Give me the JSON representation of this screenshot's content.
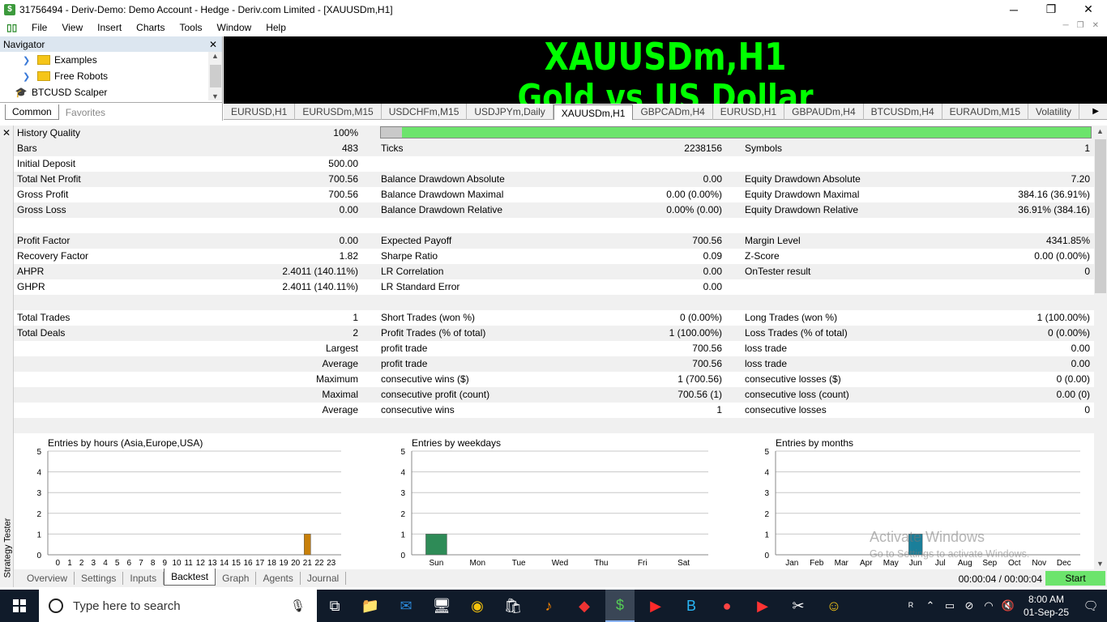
{
  "window": {
    "title": "31756494 - Deriv-Demo: Demo Account - Hedge - Deriv.com Limited - [XAUUSDm,H1]"
  },
  "menu": [
    "File",
    "View",
    "Insert",
    "Charts",
    "Tools",
    "Window",
    "Help"
  ],
  "navigator": {
    "title": "Navigator",
    "items": [
      {
        "label": "Examples",
        "icon": "folder-icon"
      },
      {
        "label": "Free Robots",
        "icon": "folder-icon"
      },
      {
        "label": "BTCUSD Scalper",
        "icon": "graduation-cap-icon"
      }
    ],
    "tabs": [
      "Common",
      "Favorites"
    ]
  },
  "chart": {
    "symbol_title": "XAUUSDm,H1",
    "description": "Gold vs US Dollar",
    "text_color": "#00ff00",
    "tabs": [
      "EURUSD,H1",
      "EURUSDm,M15",
      "USDCHFm,M15",
      "USDJPYm,Daily",
      "XAUUSDm,H1",
      "GBPCADm,H4",
      "EURUSD,H1",
      "GBPAUDm,H4",
      "BTCUSDm,H4",
      "EURAUDm,M15",
      "Volatility"
    ],
    "active_tab": 4
  },
  "report": {
    "history_quality": {
      "label": "History Quality",
      "value": "100%",
      "fraction": 1.0
    },
    "rows": [
      {
        "c": [
          "Bars",
          "483",
          "Ticks",
          "2238156",
          "Symbols",
          "1"
        ],
        "shade": true
      },
      {
        "c": [
          "Initial Deposit",
          "500.00",
          "",
          "",
          "",
          ""
        ],
        "shade": false
      },
      {
        "c": [
          "Total Net Profit",
          "700.56",
          "Balance Drawdown Absolute",
          "0.00",
          "Equity Drawdown Absolute",
          "7.20"
        ],
        "shade": true
      },
      {
        "c": [
          "Gross Profit",
          "700.56",
          "Balance Drawdown Maximal",
          "0.00 (0.00%)",
          "Equity Drawdown Maximal",
          "384.16 (36.91%)"
        ],
        "shade": false
      },
      {
        "c": [
          "Gross Loss",
          "0.00",
          "Balance Drawdown Relative",
          "0.00% (0.00)",
          "Equity Drawdown Relative",
          "36.91% (384.16)"
        ],
        "shade": true
      },
      {
        "c": [
          "",
          "",
          "",
          "",
          "",
          ""
        ],
        "shade": false
      },
      {
        "c": [
          "Profit Factor",
          "0.00",
          "Expected Payoff",
          "700.56",
          "Margin Level",
          "4341.85%"
        ],
        "shade": true
      },
      {
        "c": [
          "Recovery Factor",
          "1.82",
          "Sharpe Ratio",
          "0.09",
          "Z-Score",
          "0.00 (0.00%)"
        ],
        "shade": false
      },
      {
        "c": [
          "AHPR",
          "2.4011 (140.11%)",
          "LR Correlation",
          "0.00",
          "OnTester result",
          "0"
        ],
        "shade": true
      },
      {
        "c": [
          "GHPR",
          "2.4011 (140.11%)",
          "LR Standard Error",
          "0.00",
          "",
          ""
        ],
        "shade": false
      },
      {
        "c": [
          "",
          "",
          "",
          "",
          "",
          ""
        ],
        "shade": true
      },
      {
        "c": [
          "Total Trades",
          "1",
          "Short Trades (won %)",
          "0 (0.00%)",
          "Long Trades (won %)",
          "1 (100.00%)"
        ],
        "shade": false
      },
      {
        "c": [
          "Total Deals",
          "2",
          "Profit Trades (% of total)",
          "1 (100.00%)",
          "Loss Trades (% of total)",
          "0 (0.00%)"
        ],
        "shade": true
      },
      {
        "c": [
          "",
          "Largest",
          "profit trade",
          "700.56",
          "loss trade",
          "0.00"
        ],
        "shade": false
      },
      {
        "c": [
          "",
          "Average",
          "profit trade",
          "700.56",
          "loss trade",
          "0.00"
        ],
        "shade": true
      },
      {
        "c": [
          "",
          "Maximum",
          "consecutive wins ($)",
          "1 (700.56)",
          "consecutive losses ($)",
          "0 (0.00)"
        ],
        "shade": false
      },
      {
        "c": [
          "",
          "Maximal",
          "consecutive profit (count)",
          "700.56 (1)",
          "consecutive loss (count)",
          "0.00 (0)"
        ],
        "shade": true
      },
      {
        "c": [
          "",
          "Average",
          "consecutive wins",
          "1",
          "consecutive losses",
          "0"
        ],
        "shade": false
      },
      {
        "c": [
          "",
          "",
          "",
          "",
          "",
          ""
        ],
        "shade": true
      }
    ]
  },
  "chart_data": [
    {
      "type": "bar",
      "title": "Entries by hours (Asia,Europe,USA)",
      "categories": [
        "0",
        "1",
        "2",
        "3",
        "4",
        "5",
        "6",
        "7",
        "8",
        "9",
        "10",
        "11",
        "12",
        "13",
        "14",
        "15",
        "16",
        "17",
        "18",
        "19",
        "20",
        "21",
        "22",
        "23"
      ],
      "values": [
        0,
        0,
        0,
        0,
        0,
        0,
        0,
        0,
        0,
        0,
        0,
        0,
        0,
        0,
        0,
        0,
        0,
        0,
        0,
        0,
        0,
        1,
        0,
        0
      ],
      "ylim": [
        0,
        5
      ],
      "yticks": [
        "0",
        "1",
        "2",
        "3",
        "4",
        "5"
      ],
      "color": "#c8800a",
      "grid": true
    },
    {
      "type": "bar",
      "title": "Entries by weekdays",
      "categories": [
        "Sun",
        "Mon",
        "Tue",
        "Wed",
        "Thu",
        "Fri",
        "Sat"
      ],
      "values": [
        1,
        0,
        0,
        0,
        0,
        0,
        0
      ],
      "ylim": [
        0,
        5
      ],
      "yticks": [
        "0",
        "1",
        "2",
        "3",
        "4",
        "5"
      ],
      "color": "#2e8b57",
      "grid": true
    },
    {
      "type": "bar",
      "title": "Entries by months",
      "categories": [
        "Jan",
        "Feb",
        "Mar",
        "Apr",
        "May",
        "Jun",
        "Jul",
        "Aug",
        "Sep",
        "Oct",
        "Nov",
        "Dec"
      ],
      "values": [
        0,
        0,
        0,
        0,
        0,
        1,
        0,
        0,
        0,
        0,
        0,
        0
      ],
      "ylim": [
        0,
        5
      ],
      "yticks": [
        "0",
        "1",
        "2",
        "3",
        "4",
        "5"
      ],
      "color": "#1a7f9a",
      "grid": true
    }
  ],
  "tester": {
    "side_label": "Strategy Tester",
    "tabs": [
      "Overview",
      "Settings",
      "Inputs",
      "Backtest",
      "Graph",
      "Agents",
      "Journal"
    ],
    "active_tab": 3,
    "timer": "00:00:04 / 00:00:04",
    "start_label": "Start"
  },
  "watermark": {
    "line1": "Activate Windows",
    "line2": "Go to Settings to activate Windows."
  },
  "taskbar": {
    "search_placeholder": "Type here to search",
    "time": "8:00 AM",
    "date": "01-Sep-25",
    "apps": [
      "task-view-icon",
      "file-explorer-icon",
      "mail-icon",
      "remote-desktop-icon",
      "chrome-icon",
      "store-icon",
      "fl-studio-icon",
      "app-red-icon",
      "metatrader-icon",
      "youtube-icon",
      "b-app-icon",
      "media-app-icon",
      "video-app-icon",
      "capcut-icon",
      "team-app-icon"
    ]
  }
}
